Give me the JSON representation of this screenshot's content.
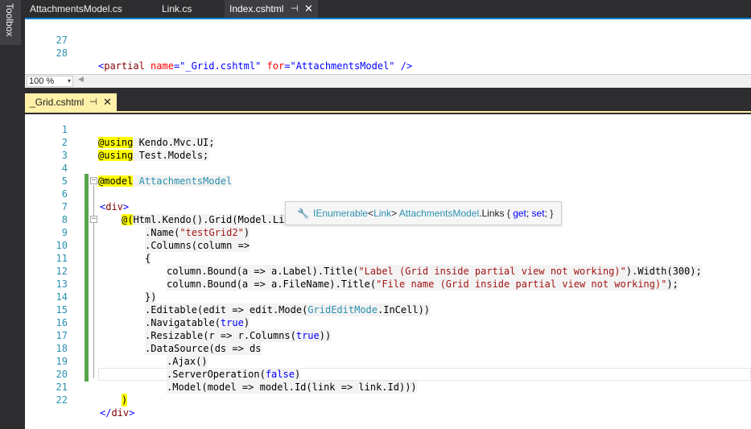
{
  "toolbox": {
    "label": "Toolbox"
  },
  "top_tabs": [
    {
      "label": "AttachmentsModel.cs"
    },
    {
      "label": "Link.cs"
    },
    {
      "label": "Index.cshtml",
      "pin": "⊣",
      "close": "✕"
    }
  ],
  "top_editor": {
    "lines": [
      {
        "num": "27"
      },
      {
        "num": "28"
      }
    ],
    "line28": {
      "open": "<",
      "tag": "partial",
      "attr1": " name",
      "eq1": "=",
      "val1": "\"_Grid.cshtml\"",
      "attr2": " for",
      "eq2": "=",
      "val2": "\"AttachmentsModel\"",
      "close": " />"
    }
  },
  "zoom": {
    "value": "100 %",
    "arrow": "▾",
    "scroll_left": "◀"
  },
  "bottom_tabs": [
    {
      "label": "_Grid.cshtml",
      "pin": "⊣",
      "close": "✕"
    }
  ],
  "code_lines": [
    {
      "num": "1"
    },
    {
      "num": "2"
    },
    {
      "num": "3"
    },
    {
      "num": "4"
    },
    {
      "num": "5"
    },
    {
      "num": "6"
    },
    {
      "num": "7"
    },
    {
      "num": "8"
    },
    {
      "num": "9"
    },
    {
      "num": "10"
    },
    {
      "num": "11"
    },
    {
      "num": "12"
    },
    {
      "num": "13"
    },
    {
      "num": "14"
    },
    {
      "num": "15"
    },
    {
      "num": "16"
    },
    {
      "num": "17"
    },
    {
      "num": "18"
    },
    {
      "num": "19"
    },
    {
      "num": "20"
    },
    {
      "num": "21"
    },
    {
      "num": "22"
    }
  ],
  "code": {
    "l1": {
      "razor": "@using",
      "rest": " Kendo.Mvc.UI;"
    },
    "l2": {
      "razor": "@using",
      "rest": " Test.Models;"
    },
    "l4": {
      "razor": "@model",
      "sp": " ",
      "type": "AttachmentsModel"
    },
    "l6": {
      "lt": "<",
      "tag": "div",
      "gt": ">"
    },
    "l7": {
      "razor": "@(",
      "rest": "Html.Kendo().Grid(Model.Links)"
    },
    "l8": {
      "pre": ".Name(",
      "str": "\"testGrid2\"",
      "post": ")"
    },
    "l9": {
      "text": ".Columns(column =>"
    },
    "l10": {
      "text": "{"
    },
    "l11": {
      "pre": "column.Bound(a => a.Label).Title(",
      "str": "\"Label (Grid inside partial view not working)\"",
      "post": ").Width(300);"
    },
    "l12": {
      "pre": "column.Bound(a => a.FileName).Title(",
      "str": "\"File name (Grid inside partial view not working)\"",
      "post": ");"
    },
    "l13": {
      "text": "})"
    },
    "l14": {
      "pre": ".Editable(edit => edit.Mode(",
      "type": "GridEditMode",
      "post": ".InCell))"
    },
    "l15": {
      "pre": ".Navigatable(",
      "kw": "true",
      "post": ")"
    },
    "l16": {
      "pre": ".Resizable(r => r.Columns(",
      "kw": "true",
      "post": "))"
    },
    "l17": {
      "text": ".DataSource(ds => ds"
    },
    "l18": {
      "text": ".Ajax()"
    },
    "l19": {
      "pre": ".ServerOperation(",
      "kw": "false",
      "post": ")"
    },
    "l20": {
      "text": ".Model(model => model.Id(link => link.Id)))"
    },
    "l21": {
      "text": ")"
    },
    "l22": {
      "lt": "</",
      "tag": "div",
      "gt": ">"
    }
  },
  "outline": {
    "minus": "−"
  },
  "tooltip": {
    "icon": "wrench-icon",
    "glyph": "🔧",
    "type1": "IEnumerable",
    "lt": "<",
    "type2": "Link",
    "gt": ">",
    "sp": " ",
    "owner": "AttachmentsModel",
    "member": ".Links { ",
    "get": "get",
    "semi1": "; ",
    "set": "set",
    "end": "; }"
  },
  "colors": {
    "accent_blue": "#007acc",
    "active_tab_yellow": "#fff1a8",
    "change_bar_green": "#57a64a",
    "razor_highlight": "#ffff00"
  }
}
